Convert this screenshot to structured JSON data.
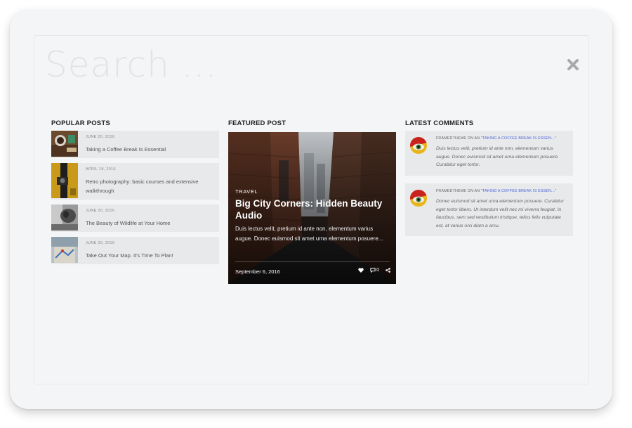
{
  "search": {
    "placeholder": "Search ..."
  },
  "close": {
    "label": "close"
  },
  "popular": {
    "heading": "POPULAR POSTS",
    "items": [
      {
        "date": "JUNE 20, 2016",
        "title": "Taking a Coffee Break Is Essential"
      },
      {
        "date": "APRIL 18, 2016",
        "title": "Retro photography: basic courses and extensive walkthrough"
      },
      {
        "date": "JUNE 20, 2016",
        "title": "The Beauty of Wildlife at Your Home"
      },
      {
        "date": "JUNE 20, 2016",
        "title": "Take Out Your Map. It's Time To Plan!"
      }
    ]
  },
  "featured": {
    "heading": "FEATURED POST",
    "category": "TRAVEL",
    "title": "Big City Corners: Hidden Beauty Audio",
    "excerpt": "Duis lectus velit, pretium id ante non, elementum varius augue. Donec euismod sit amet urna elementum posuere...",
    "date": "September 6, 2016",
    "comment_count": "0"
  },
  "comments": {
    "heading": "LATEST COMMENTS",
    "items": [
      {
        "author": "FRAMEDTHEME ON AN ",
        "link": "\"TAKING A COFFEE BREAK IS ESSEN...\"",
        "text": "Duis lectus velit, pretium id ante non, elementum varius augue. Donec euismod sit amet urna elementum posuere. Curabitur eget tortor."
      },
      {
        "author": "FRAMEDTHEME ON AN ",
        "link": "\"TAKING A COFFEE BREAK IS ESSEN...\"",
        "text": "Donec euismod sit amet urna elementum posuere. Curabitur eget tortor libero. Ut interdum velit nec mi viverra feugiat. In faucibus, sem sed vestibulum tristique, tellus felis vulputate est, at varius orci diam a arcu."
      }
    ]
  },
  "colors": {
    "accent_link": "#4a64d8",
    "panel_bg": "#f4f5f6",
    "item_bg": "#e8e9eb"
  },
  "icons": [
    "close-icon",
    "heart-icon",
    "comment-icon",
    "share-icon"
  ]
}
